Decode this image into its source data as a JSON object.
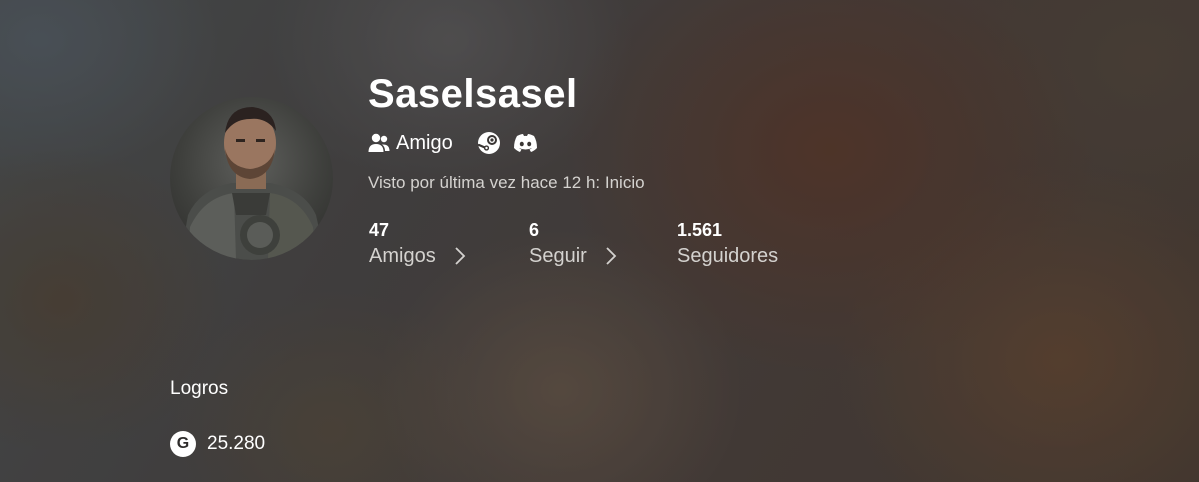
{
  "profile": {
    "gamertag": "Saselsasel",
    "avatar_icon": "gears-soldier-avatar",
    "relationship": {
      "icon": "friends-icon",
      "label": "Amigo"
    },
    "linked_accounts": [
      {
        "icon": "steam-icon"
      },
      {
        "icon": "discord-icon"
      }
    ],
    "last_seen": "Visto por última vez hace 12 h: Inicio"
  },
  "stats": {
    "friends": {
      "value": "47",
      "label": "Amigos"
    },
    "following": {
      "value": "6",
      "label": "Seguir"
    },
    "followers": {
      "value": "1.561",
      "label": "Seguidores"
    }
  },
  "achievements": {
    "title": "Logros",
    "gamerscore_icon": "G",
    "gamerscore": "25.280"
  },
  "colors": {
    "text_primary": "#ffffff",
    "text_secondary": "#d4d2cf"
  }
}
